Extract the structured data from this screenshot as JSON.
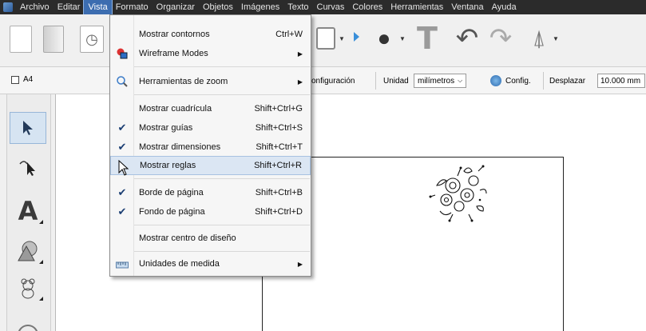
{
  "menubar": {
    "items": [
      "Archivo",
      "Editar",
      "Vista",
      "Formato",
      "Organizar",
      "Objetos",
      "Imágenes",
      "Texto",
      "Curvas",
      "Colores",
      "Herramientas",
      "Ventana",
      "Ayuda"
    ],
    "active": "Vista"
  },
  "toolbar2": {
    "page_size": "A4",
    "config_partial": "onfiguración",
    "unit_label": "Unidad",
    "unit_value": "milímetros",
    "config_label": "Config.",
    "move_label": "Desplazar",
    "move_value": "10.000 mm"
  },
  "view_menu": {
    "items": [
      {
        "label": "Mostrar contornos",
        "shortcut": "Ctrl+W"
      },
      {
        "label": "Wireframe Modes",
        "submenu": true
      },
      {
        "label": "Herramientas de zoom",
        "submenu": true
      },
      {
        "label": "Mostrar cuadrícula",
        "shortcut": "Shift+Ctrl+G"
      },
      {
        "label": "Mostrar guías",
        "shortcut": "Shift+Ctrl+S",
        "checked": true
      },
      {
        "label": "Mostrar dimensiones",
        "shortcut": "Shift+Ctrl+T",
        "checked": true
      },
      {
        "label": "Mostrar reglas",
        "shortcut": "Shift+Ctrl+R",
        "hovered": true
      },
      {
        "label": "Borde de página",
        "shortcut": "Shift+Ctrl+B",
        "checked": true
      },
      {
        "label": "Fondo de página",
        "shortcut": "Shift+Ctrl+D",
        "checked": true
      },
      {
        "label": "Mostrar centro de diseño"
      },
      {
        "label": "Unidades de medida",
        "submenu": true
      }
    ]
  },
  "colors": {
    "menubar_bg": "#2b2b2b",
    "menu_active": "#3c6db0",
    "menu_hover": "#dbe6f3",
    "check": "#1a3d72"
  }
}
